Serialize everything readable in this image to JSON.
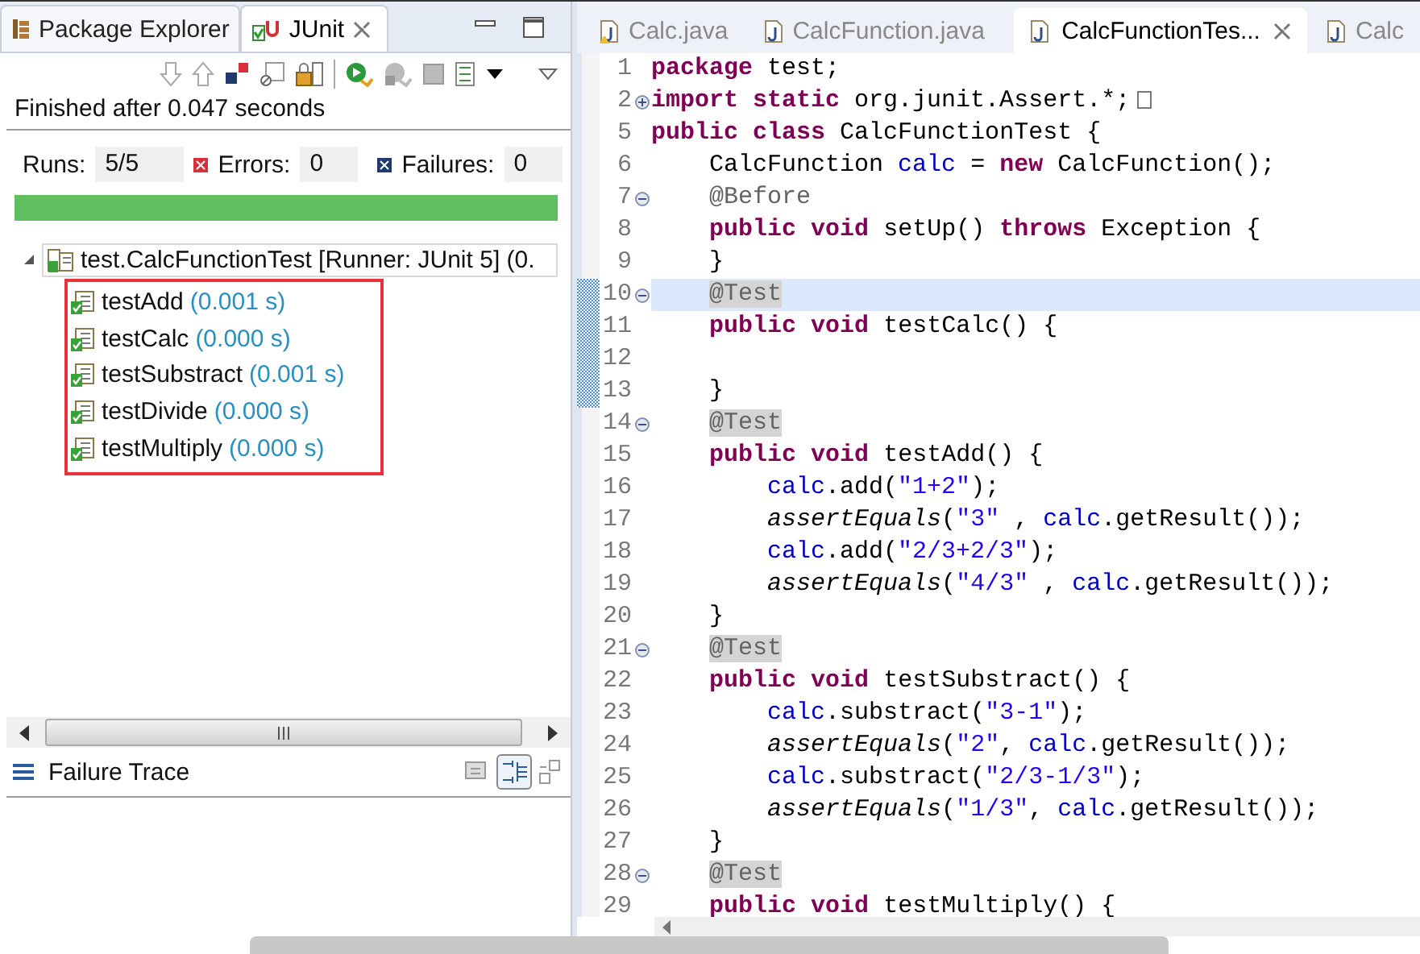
{
  "left_tabs": [
    {
      "kind": "package_explorer",
      "label": "Package Explorer",
      "selected": false
    },
    {
      "kind": "junit",
      "label": "JUnit",
      "selected": true
    }
  ],
  "junit": {
    "status": "Finished after 0.047 seconds",
    "counters": [
      {
        "kind": "runs",
        "label": "Runs:",
        "value": "5/5"
      },
      {
        "kind": "errors",
        "label": "Errors:",
        "value": "0"
      },
      {
        "kind": "failures",
        "label": "Failures:",
        "value": "0"
      }
    ],
    "progress": {
      "level": 1,
      "failed": false
    },
    "tree": {
      "label": "test.CalcFunctionTest [Runner: JUnit 5] (0.",
      "expanded": true,
      "selected": true,
      "children": [
        {
          "name": "testAdd",
          "time": "(0.001 s)",
          "passed": true,
          "selected": false
        },
        {
          "name": "testCalc",
          "time": "(0.000 s)",
          "passed": true,
          "selected": false
        },
        {
          "name": "testSubstract",
          "time": "(0.001 s)",
          "passed": true,
          "selected": false
        },
        {
          "name": "testDivide",
          "time": "(0.000 s)",
          "passed": true,
          "selected": false
        },
        {
          "name": "testMultiply",
          "time": "(0.000 s)",
          "passed": true,
          "selected": false
        }
      ]
    },
    "failure_trace": {
      "title": "Failure Trace"
    }
  },
  "editor_tabs": [
    {
      "label": "Calc.java",
      "warning": true,
      "selected": false
    },
    {
      "label": "CalcFunction.java",
      "warning": false,
      "selected": false
    },
    {
      "label": "CalcFunctionTes...",
      "warning": false,
      "selected": true
    },
    {
      "label": "Calc",
      "warning": false,
      "selected": false
    }
  ],
  "code_lines": [
    {
      "number": "1",
      "fold_marker": false,
      "current": false,
      "changed": false,
      "tokens": [
        {
          "kind": "keyword",
          "text": "package"
        },
        {
          "kind": "plain",
          "text": " test;"
        }
      ]
    },
    {
      "number": "2",
      "fold_marker": true,
      "folded": true,
      "current": false,
      "changed": false,
      "tokens": [
        {
          "kind": "keyword",
          "text": "import static"
        },
        {
          "kind": "plain",
          "text": " org.junit.Assert.*;"
        }
      ]
    },
    {
      "number": "5",
      "fold_marker": false,
      "current": false,
      "changed": false,
      "tokens": [
        {
          "kind": "keyword",
          "text": "public class"
        },
        {
          "kind": "plain",
          "text": " CalcFunctionTest {"
        }
      ]
    },
    {
      "number": "6",
      "fold_marker": false,
      "current": false,
      "changed": false,
      "tokens": [
        {
          "kind": "plain",
          "text": "    CalcFunction "
        },
        {
          "kind": "field",
          "text": "calc"
        },
        {
          "kind": "plain",
          "text": " = "
        },
        {
          "kind": "keyword",
          "text": "new"
        },
        {
          "kind": "plain",
          "text": " CalcFunction();"
        }
      ]
    },
    {
      "number": "7",
      "fold_marker": true,
      "folded": false,
      "current": false,
      "changed": false,
      "tokens": [
        {
          "kind": "annotation",
          "text": "    @Before"
        }
      ]
    },
    {
      "number": "8",
      "fold_marker": false,
      "current": false,
      "changed": false,
      "tokens": [
        {
          "kind": "keyword",
          "text": "    public void"
        },
        {
          "kind": "plain",
          "text": " setUp() "
        },
        {
          "kind": "keyword",
          "text": "throws"
        },
        {
          "kind": "plain",
          "text": " Exception {"
        }
      ]
    },
    {
      "number": "9",
      "fold_marker": false,
      "current": false,
      "changed": false,
      "tokens": [
        {
          "kind": "plain",
          "text": "    }"
        }
      ]
    },
    {
      "number": "10",
      "fold_marker": true,
      "folded": false,
      "current": true,
      "changed": true,
      "tokens": [
        {
          "kind": "annotation_marked",
          "text": "    @Test"
        }
      ]
    },
    {
      "number": "11",
      "fold_marker": false,
      "current": false,
      "changed": true,
      "tokens": [
        {
          "kind": "keyword",
          "text": "    public void"
        },
        {
          "kind": "plain",
          "text": " testCalc() {"
        }
      ]
    },
    {
      "number": "12",
      "fold_marker": false,
      "current": false,
      "changed": true
    },
    {
      "number": "13",
      "fold_marker": false,
      "current": false,
      "changed": true,
      "tokens": [
        {
          "kind": "plain",
          "text": "    }"
        }
      ]
    },
    {
      "number": "14",
      "fold_marker": true,
      "folded": false,
      "current": false,
      "changed": false,
      "tokens": [
        {
          "kind": "annotation_marked",
          "text": "    @Test"
        }
      ]
    },
    {
      "number": "15",
      "fold_marker": false,
      "current": false,
      "changed": false,
      "tokens": [
        {
          "kind": "keyword",
          "text": "    public void"
        },
        {
          "kind": "plain",
          "text": " testAdd() {"
        }
      ]
    },
    {
      "number": "16",
      "fold_marker": false,
      "current": false,
      "changed": false,
      "tokens": [
        {
          "kind": "field",
          "text": "        calc"
        },
        {
          "kind": "plain",
          "text": ".add("
        },
        {
          "kind": "string",
          "text": "\"1+2\""
        },
        {
          "kind": "plain",
          "text": ");"
        }
      ]
    },
    {
      "number": "17",
      "fold_marker": false,
      "current": false,
      "changed": false,
      "tokens": [
        {
          "kind": "static",
          "text": "        assertEquals"
        },
        {
          "kind": "plain",
          "text": "("
        },
        {
          "kind": "string",
          "text": "\"3\""
        },
        {
          "kind": "plain",
          "text": " , "
        },
        {
          "kind": "field",
          "text": "calc"
        },
        {
          "kind": "plain",
          "text": ".getResult());"
        }
      ]
    },
    {
      "number": "18",
      "fold_marker": false,
      "current": false,
      "changed": false,
      "tokens": [
        {
          "kind": "field",
          "text": "        calc"
        },
        {
          "kind": "plain",
          "text": ".add("
        },
        {
          "kind": "string",
          "text": "\"2/3+2/3\""
        },
        {
          "kind": "plain",
          "text": ");"
        }
      ]
    },
    {
      "number": "19",
      "fold_marker": false,
      "current": false,
      "changed": false,
      "tokens": [
        {
          "kind": "static",
          "text": "        assertEquals"
        },
        {
          "kind": "plain",
          "text": "("
        },
        {
          "kind": "string",
          "text": "\"4/3\""
        },
        {
          "kind": "plain",
          "text": " , "
        },
        {
          "kind": "field",
          "text": "calc"
        },
        {
          "kind": "plain",
          "text": ".getResult());"
        }
      ]
    },
    {
      "number": "20",
      "fold_marker": false,
      "current": false,
      "changed": false,
      "tokens": [
        {
          "kind": "plain",
          "text": "    }"
        }
      ]
    },
    {
      "number": "21",
      "fold_marker": true,
      "folded": false,
      "current": false,
      "changed": false,
      "tokens": [
        {
          "kind": "annotation_marked",
          "text": "    @Test"
        }
      ]
    },
    {
      "number": "22",
      "fold_marker": false,
      "current": false,
      "changed": false,
      "tokens": [
        {
          "kind": "keyword",
          "text": "    public void"
        },
        {
          "kind": "plain",
          "text": " testSubstract() {"
        }
      ]
    },
    {
      "number": "23",
      "fold_marker": false,
      "current": false,
      "changed": false,
      "tokens": [
        {
          "kind": "field",
          "text": "        calc"
        },
        {
          "kind": "plain",
          "text": ".substract("
        },
        {
          "kind": "string",
          "text": "\"3-1\""
        },
        {
          "kind": "plain",
          "text": ");"
        }
      ]
    },
    {
      "number": "24",
      "fold_marker": false,
      "current": false,
      "changed": false,
      "tokens": [
        {
          "kind": "static",
          "text": "        assertEquals"
        },
        {
          "kind": "plain",
          "text": "("
        },
        {
          "kind": "string",
          "text": "\"2\""
        },
        {
          "kind": "plain",
          "text": ", "
        },
        {
          "kind": "field",
          "text": "calc"
        },
        {
          "kind": "plain",
          "text": ".getResult());"
        }
      ]
    },
    {
      "number": "25",
      "fold_marker": false,
      "current": false,
      "changed": false,
      "tokens": [
        {
          "kind": "field",
          "text": "        calc"
        },
        {
          "kind": "plain",
          "text": ".substract("
        },
        {
          "kind": "string",
          "text": "\"2/3-1/3\""
        },
        {
          "kind": "plain",
          "text": ");"
        }
      ]
    },
    {
      "number": "26",
      "fold_marker": false,
      "current": false,
      "changed": false,
      "tokens": [
        {
          "kind": "static",
          "text": "        assertEquals"
        },
        {
          "kind": "plain",
          "text": "("
        },
        {
          "kind": "string",
          "text": "\"1/3\""
        },
        {
          "kind": "plain",
          "text": ", "
        },
        {
          "kind": "field",
          "text": "calc"
        },
        {
          "kind": "plain",
          "text": ".getResult());"
        }
      ]
    },
    {
      "number": "27",
      "fold_marker": false,
      "current": false,
      "changed": false,
      "tokens": [
        {
          "kind": "plain",
          "text": "    }"
        }
      ]
    },
    {
      "number": "28",
      "fold_marker": true,
      "folded": false,
      "current": false,
      "changed": false,
      "tokens": [
        {
          "kind": "annotation_marked",
          "text": "    @Test"
        }
      ]
    },
    {
      "number": "29",
      "fold_marker": false,
      "current": false,
      "changed": false,
      "tokens": [
        {
          "kind": "keyword",
          "text": "    public void"
        },
        {
          "kind": "plain",
          "text": " testMultiply() {"
        }
      ]
    }
  ]
}
